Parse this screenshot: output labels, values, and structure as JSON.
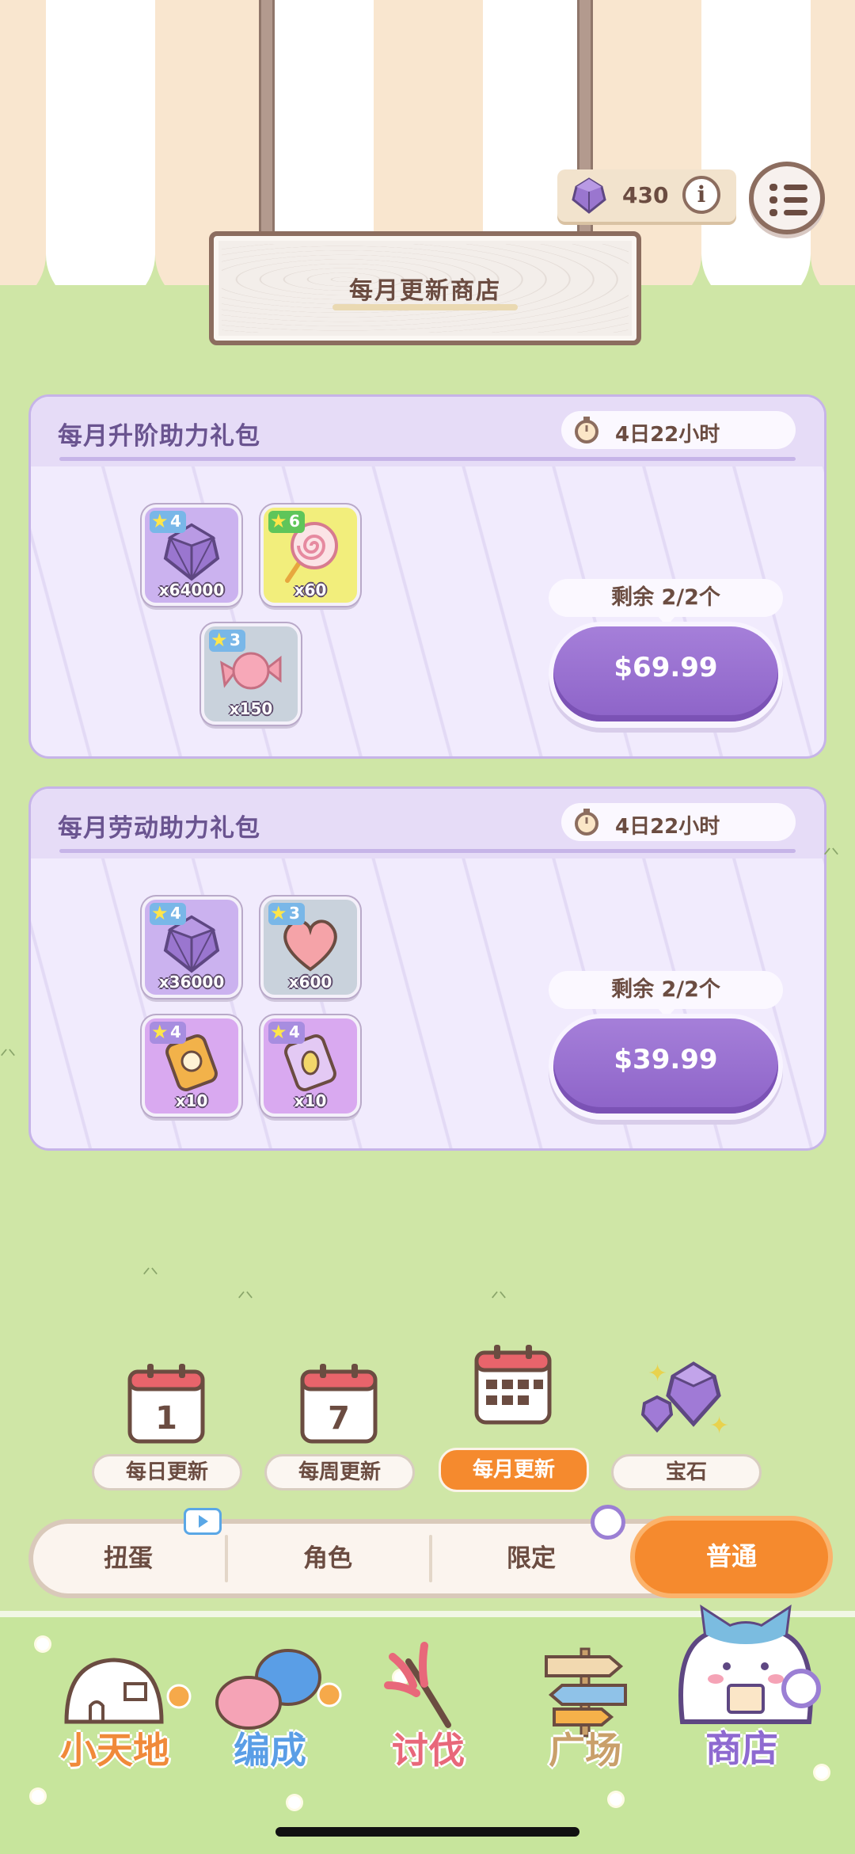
{
  "currency": {
    "amount": "430",
    "info_symbol": "i"
  },
  "sign": {
    "title": "每月更新商店"
  },
  "packs": [
    {
      "title": "每月升阶助力礼包",
      "timer": "4日22小时",
      "items": [
        {
          "name": "gem",
          "stars": "4",
          "qty": "x64000",
          "color": "purple"
        },
        {
          "name": "lollipop",
          "stars": "6",
          "qty": "x60",
          "color": "yellow"
        },
        {
          "name": "candy",
          "stars": "3",
          "qty": "x150",
          "color": "grey"
        }
      ],
      "remaining": "剩余 2/2个",
      "price": "$69.99"
    },
    {
      "title": "每月劳动助力礼包",
      "timer": "4日22小时",
      "items": [
        {
          "name": "gem",
          "stars": "4",
          "qty": "x36000",
          "color": "purple"
        },
        {
          "name": "heart",
          "stars": "3",
          "qty": "x600",
          "color": "grey"
        },
        {
          "name": "ticket-orange",
          "stars": "4",
          "qty": "x10",
          "color": "violet"
        },
        {
          "name": "ticket-purple",
          "stars": "4",
          "qty": "x10",
          "color": "violet"
        }
      ],
      "remaining": "剩余 2/2个",
      "price": "$39.99"
    }
  ],
  "sub_tabs": [
    {
      "label": "每日更新",
      "icon_text": "1",
      "active": false
    },
    {
      "label": "每周更新",
      "icon_text": "7",
      "active": false
    },
    {
      "label": "每月更新",
      "active": true
    },
    {
      "label": "宝石",
      "active": false
    }
  ],
  "segments": [
    {
      "label": "扭蛋"
    },
    {
      "label": "角色"
    },
    {
      "label": "限定"
    },
    {
      "label": "普通",
      "active": true
    }
  ],
  "bottom_nav": [
    {
      "label": "小天地",
      "color": "#f08a3a"
    },
    {
      "label": "编成",
      "color": "#5a9ee6"
    },
    {
      "label": "讨伐",
      "color": "#e8687a"
    },
    {
      "label": "广场",
      "color": "#c9a06a"
    },
    {
      "label": "商店",
      "color": "#8e6ad0",
      "active": true
    }
  ],
  "colors": {
    "accent_orange": "#f58a2e",
    "purple_button": "#8d63c8",
    "meadow": "#cfe6a6"
  }
}
